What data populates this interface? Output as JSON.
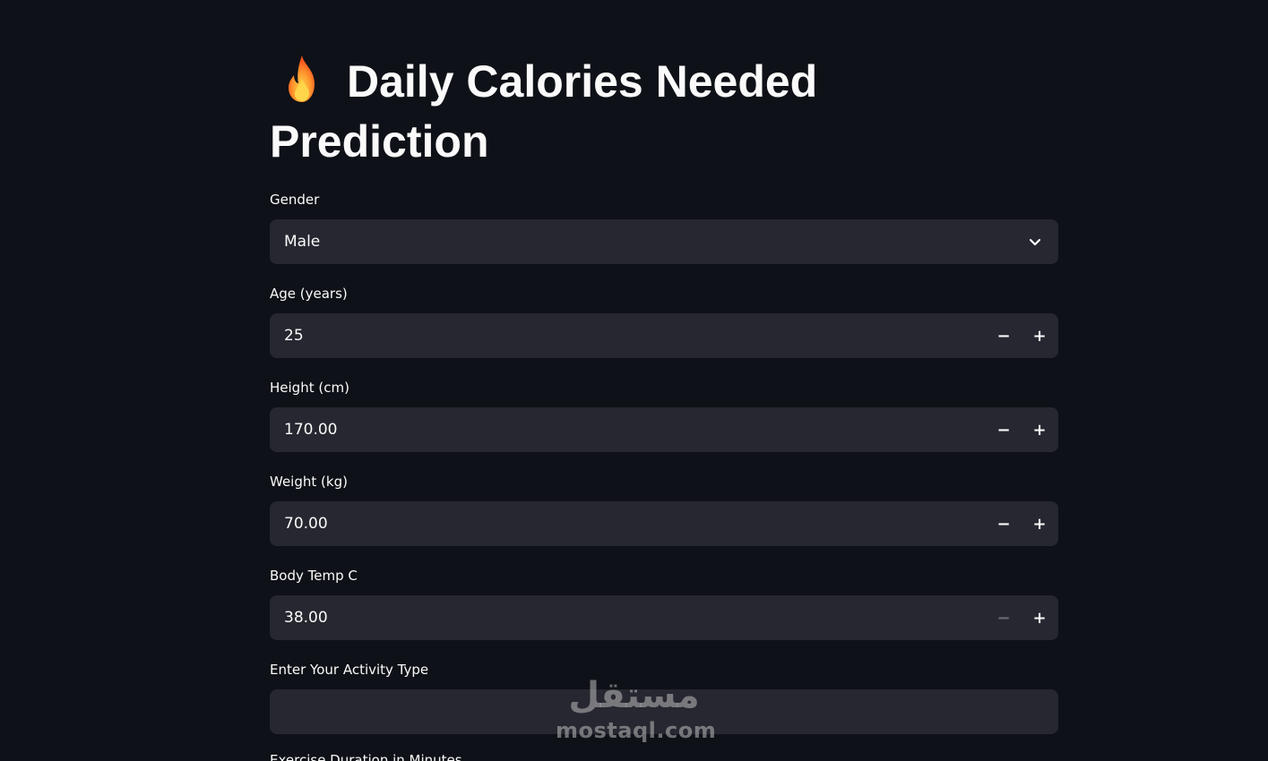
{
  "page": {
    "title": "Daily Calories Needed Prediction"
  },
  "fields": {
    "gender": {
      "label": "Gender",
      "value": "Male"
    },
    "age": {
      "label": "Age (years)",
      "value": "25"
    },
    "height": {
      "label": "Height (cm)",
      "value": "170.00"
    },
    "weight": {
      "label": "Weight (kg)",
      "value": "70.00"
    },
    "body_temp": {
      "label": "Body Temp C",
      "value": "38.00"
    },
    "activity": {
      "label": "Enter Your Activity Type",
      "value": ""
    },
    "duration": {
      "label": "Exercise Duration in Minutes"
    }
  },
  "icons": {
    "title_icon": "fire-icon",
    "select_icon": "chevron-down-icon",
    "minus_icon": "minus-icon",
    "plus_icon": "plus-icon"
  },
  "stepper": {
    "minus": "−",
    "plus": "+"
  },
  "watermark": {
    "arabic": "مستقل",
    "latin": "mostaql.com"
  },
  "colors": {
    "background": "#0e1117",
    "input_background": "#262730",
    "text": "#fafafa",
    "disabled": "#6b6d75"
  }
}
